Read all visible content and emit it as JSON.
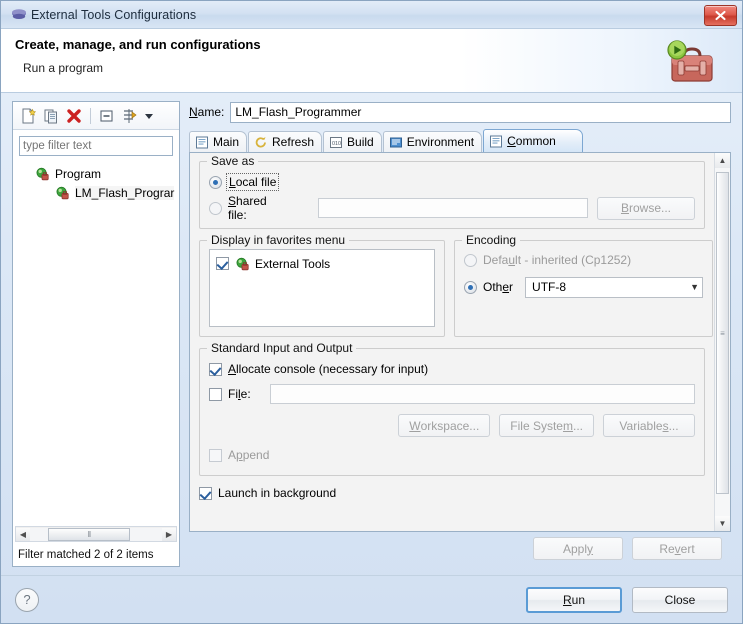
{
  "window": {
    "title": "External Tools Configurations",
    "icon": "eclipse-disc-icon",
    "close_label": "x"
  },
  "header": {
    "title": "Create, manage, and run configurations",
    "subtitle": "Run a program",
    "icon": "toolbox-run-icon"
  },
  "sidebar": {
    "toolbar": [
      {
        "name": "new-configuration-icon",
        "tooltip": "New launch configuration"
      },
      {
        "name": "duplicate-configuration-icon",
        "tooltip": "Duplicate"
      },
      {
        "name": "delete-configuration-icon",
        "tooltip": "Delete"
      },
      {
        "name": "collapse-all-icon",
        "tooltip": "Collapse All"
      },
      {
        "name": "filter-launch-configurations-icon",
        "tooltip": "Filter"
      },
      {
        "name": "chevron-down-icon",
        "tooltip": "Menu"
      }
    ],
    "filter_placeholder": "type filter text",
    "filter_value": "",
    "tree": [
      {
        "label": "Program",
        "icon": "program-config-icon",
        "level": 0
      },
      {
        "label": "LM_Flash_Prograr",
        "icon": "program-config-icon",
        "level": 1,
        "selected": true
      }
    ],
    "status": "Filter matched 2 of 2 items",
    "hscroll_grip": "‖"
  },
  "config": {
    "name_label": "Name:",
    "name_value": "LM_Flash_Programmer",
    "tabs": [
      {
        "label": "Main",
        "icon": "main-tab-icon",
        "active": false
      },
      {
        "label": "Refresh",
        "icon": "refresh-tab-icon",
        "active": false
      },
      {
        "label": "Build",
        "icon": "build-tab-icon",
        "active": false
      },
      {
        "label": "Environment",
        "icon": "environment-tab-icon",
        "active": false
      },
      {
        "label": "Common",
        "icon": "common-tab-icon",
        "active": true,
        "mnemonic": "C"
      }
    ]
  },
  "common_tab": {
    "save_as": {
      "group_label": "Save as",
      "local_file": {
        "label": "Local file",
        "selected": true,
        "mnemonic": "L"
      },
      "shared_file": {
        "label": "Shared file:",
        "selected": false,
        "mnemonic": "S"
      },
      "shared_path_value": "",
      "browse_label": "Browse...",
      "browse_enabled": false
    },
    "favorites": {
      "group_label": "Display in favorites menu",
      "items": [
        {
          "label": "External Tools",
          "checked": true,
          "icon": "external-tools-icon"
        }
      ]
    },
    "encoding": {
      "group_label": "Encoding",
      "default_option": {
        "label": "Default - inherited (Cp1252)",
        "selected": false,
        "mnemonic": "u"
      },
      "other_option": {
        "label": "Other",
        "selected": true,
        "mnemonic": "e"
      },
      "other_value": "UTF-8"
    },
    "standard_io": {
      "group_label": "Standard Input and Output",
      "allocate_console": {
        "label": "Allocate console (necessary for input)",
        "checked": true,
        "mnemonic": "A"
      },
      "file": {
        "label": "File:",
        "checked": false,
        "mnemonic": "l"
      },
      "file_value": "",
      "buttons": [
        {
          "label": "Workspace...",
          "enabled": false,
          "mnemonic": "W"
        },
        {
          "label": "File System...",
          "enabled": false,
          "mnemonic": "m"
        },
        {
          "label": "Variables...",
          "enabled": false,
          "mnemonic": "s"
        }
      ],
      "append": {
        "label": "Append",
        "checked": false,
        "enabled": false,
        "mnemonic": "p"
      }
    },
    "launch_in_background": {
      "label": "Launch in background",
      "checked": true,
      "mnemonic": "g"
    }
  },
  "actions": {
    "apply": {
      "label": "Apply",
      "enabled": false,
      "mnemonic": "y"
    },
    "revert": {
      "label": "Revert",
      "enabled": false,
      "mnemonic": "v"
    },
    "help": {
      "label": "?",
      "name": "help-icon"
    },
    "run": {
      "label": "Run",
      "default": true,
      "mnemonic": "R"
    },
    "close": {
      "label": "Close"
    }
  },
  "colors": {
    "accent": "#2e6fb5",
    "default_button_border": "#5a9bd5",
    "close_button": "#c63a2c",
    "title_text": "#1d2c3d",
    "config_icon_green": "#3ea53e",
    "toolbox_red": "#c35b52"
  }
}
